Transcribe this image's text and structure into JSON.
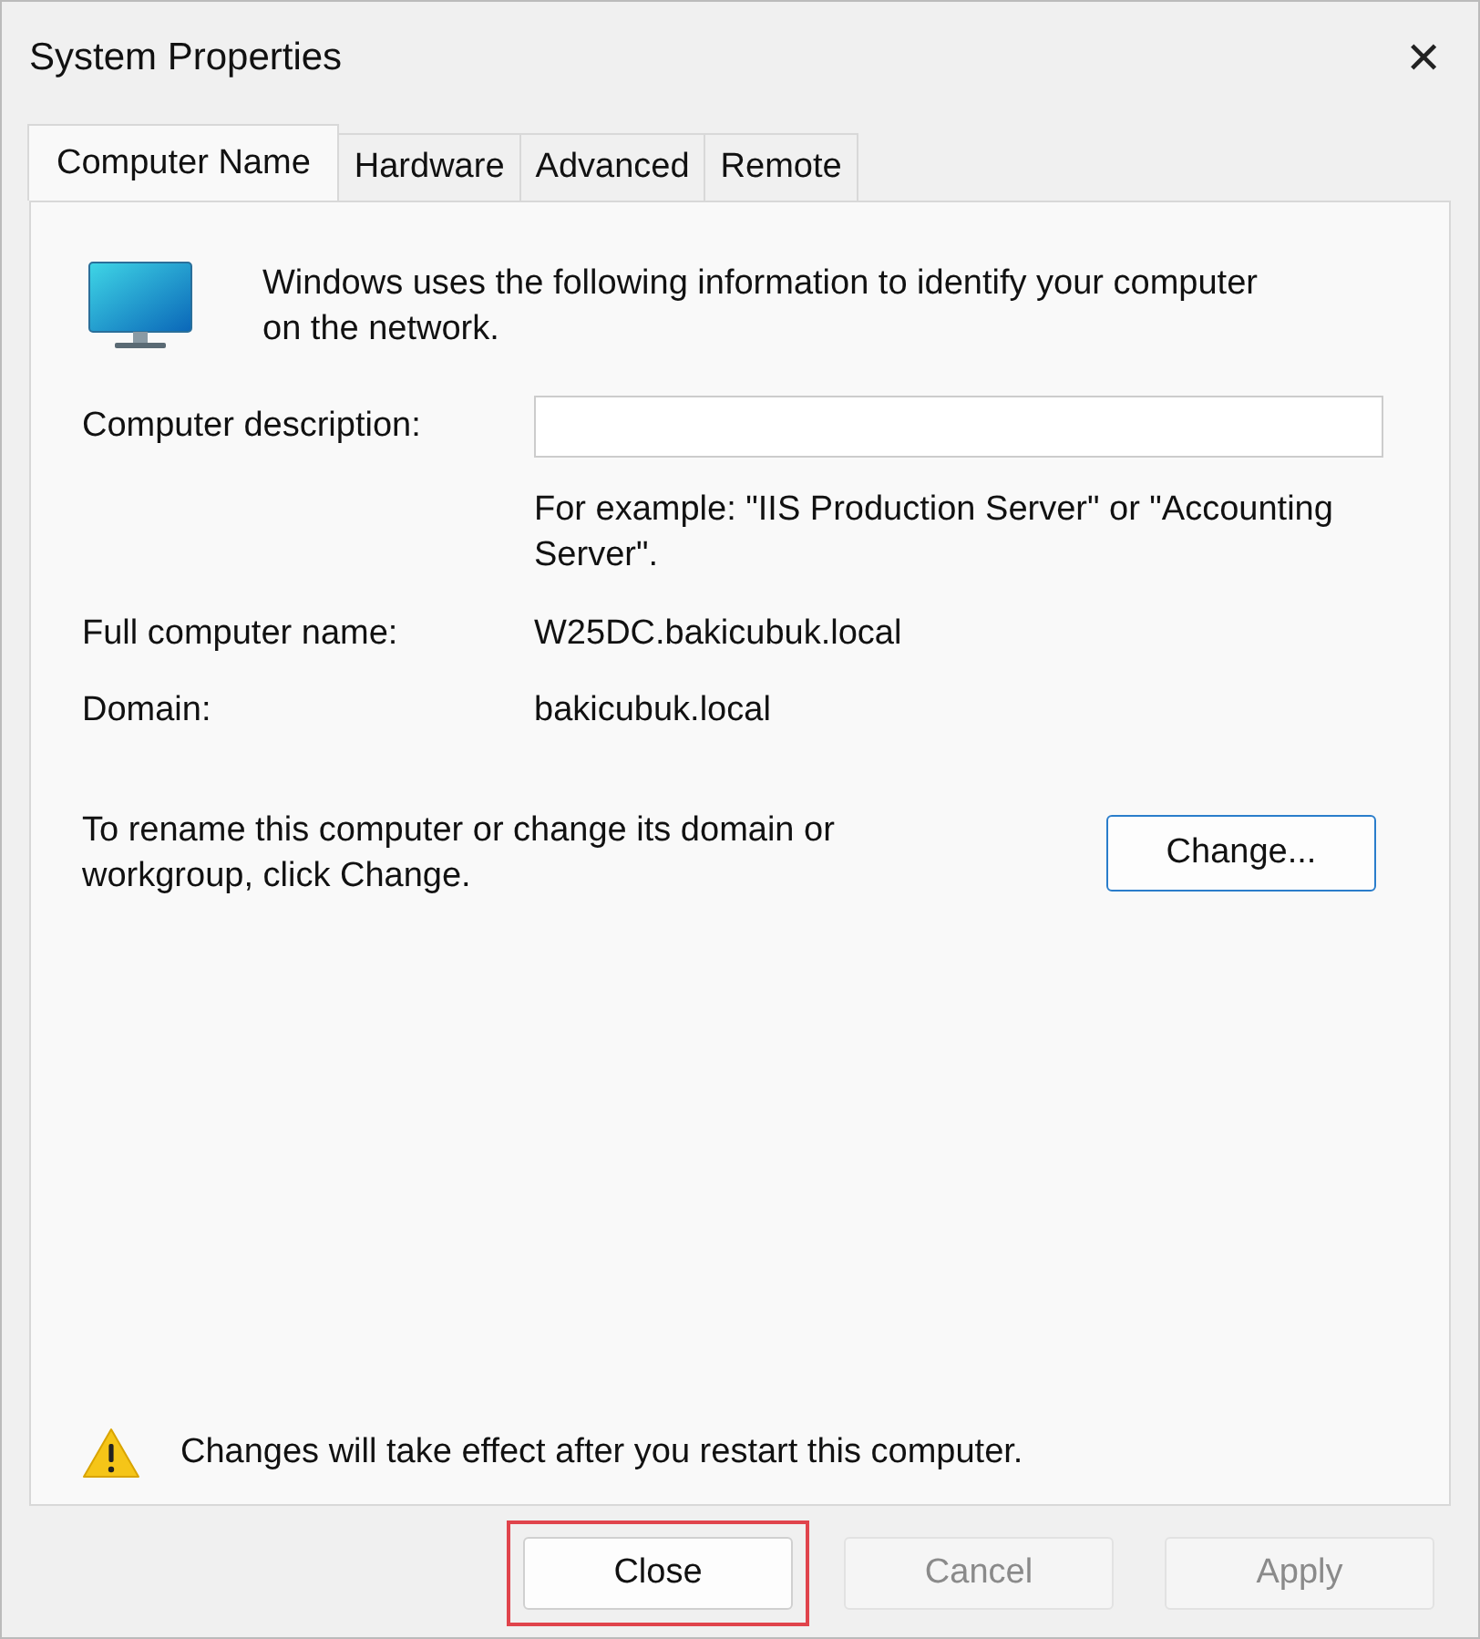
{
  "window": {
    "title": "System Properties",
    "close": "✕"
  },
  "tabs": [
    {
      "label": "Computer Name",
      "selected": true
    },
    {
      "label": "Hardware",
      "selected": false
    },
    {
      "label": "Advanced",
      "selected": false
    },
    {
      "label": "Remote",
      "selected": false
    }
  ],
  "intro": "Windows uses the following information to identify your computer on the network.",
  "description": {
    "label": "Computer description:",
    "hint": "For example: \"IIS Production Server\" or \"Accounting Server\"."
  },
  "fields": [
    {
      "label": "Full computer name:",
      "value": "W25DC.bakicubuk.local"
    },
    {
      "label": "Domain:",
      "value": "bakicubuk.local"
    }
  ],
  "rename": {
    "text": "To rename this computer or change its domain or workgroup, click Change.",
    "button": "Change..."
  },
  "warning": "Changes will take effect after you restart this computer.",
  "buttons": [
    {
      "label": "Close",
      "disabled": false,
      "highlighted": true
    },
    {
      "label": "Cancel",
      "disabled": true,
      "highlighted": false
    },
    {
      "label": "Apply",
      "disabled": true,
      "highlighted": false
    }
  ]
}
